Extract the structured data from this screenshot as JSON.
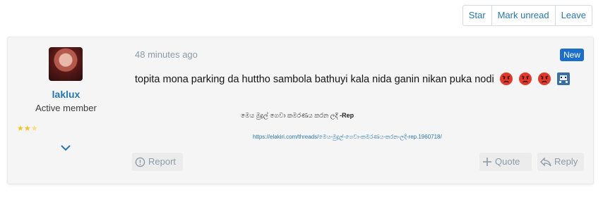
{
  "thread_actions": {
    "star": "Star",
    "mark_unread": "Mark unread",
    "leave": "Leave"
  },
  "user": {
    "name": "laklux",
    "title": "Active member",
    "rating_stars": 2.5
  },
  "post": {
    "time": "48 minutes ago",
    "badge": "New",
    "message": "topita mona parking da huttho sambola bathuyi kala nida ganin nikan puka nodi",
    "emojis": [
      "angry-face-icon",
      "angry-face-icon",
      "angry-face-icon",
      "game-invader-icon"
    ],
    "signature_title": "මෙය මුද්‍රල් ගෙවා කමරණය කරන ලදි",
    "signature_suffix": " -Rep",
    "signature_link": "https://elakiri.com/threads/මෙය-මුද්‍රල්-ගෙවා-කමරණය-කරන-ලදි-rep.1960718/"
  },
  "actions": {
    "report": "Report",
    "quote": "Quote",
    "reply": "Reply"
  },
  "colors": {
    "accent": "#2577b1",
    "badge": "#1b6ec9",
    "muted": "#8c9aaa",
    "angry": "#e03b2a"
  }
}
